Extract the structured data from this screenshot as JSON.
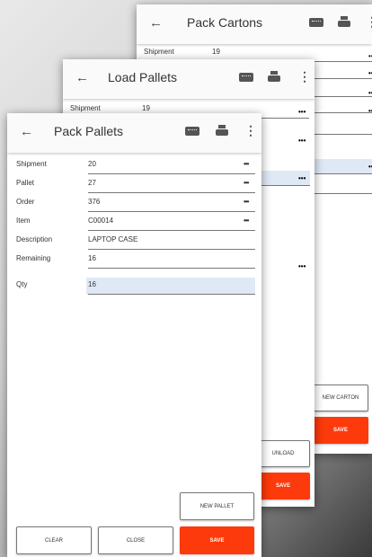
{
  "screen_cartons": {
    "title": "Pack Cartons",
    "fields": [
      {
        "label": "Shipment",
        "value": "19"
      }
    ],
    "new_carton_label": "NEW CARTON",
    "save_label": "SAVE"
  },
  "screen_load": {
    "title": "Load Pallets",
    "fields": [
      {
        "label": "Shipment",
        "value": "19"
      }
    ],
    "unload_label": "UNLOAD",
    "save_label": "SAVE"
  },
  "screen_pack": {
    "title": "Pack Pallets",
    "fields": [
      {
        "label": "Shipment",
        "value": "20"
      },
      {
        "label": "Pallet",
        "value": "27"
      },
      {
        "label": "Order",
        "value": "376"
      },
      {
        "label": "Item",
        "value": "C00014"
      },
      {
        "label": "Description",
        "value": "LAPTOP CASE"
      },
      {
        "label": "Remaining",
        "value": "16"
      },
      {
        "label": "Qty",
        "value": "16"
      }
    ],
    "new_pallet_label": "NEW PALLET",
    "clear_label": "CLEAR",
    "close_label": "CLOSE",
    "save_label": "SAVE"
  },
  "icons": {
    "back": "arrow-left-icon",
    "keyboard": "keyboard-icon",
    "print": "printer-icon",
    "more": "more-vertical-icon",
    "lookup": "ellipsis-icon"
  },
  "colors": {
    "accent": "#fd3a0b",
    "highlight": "#dfe9f5"
  }
}
